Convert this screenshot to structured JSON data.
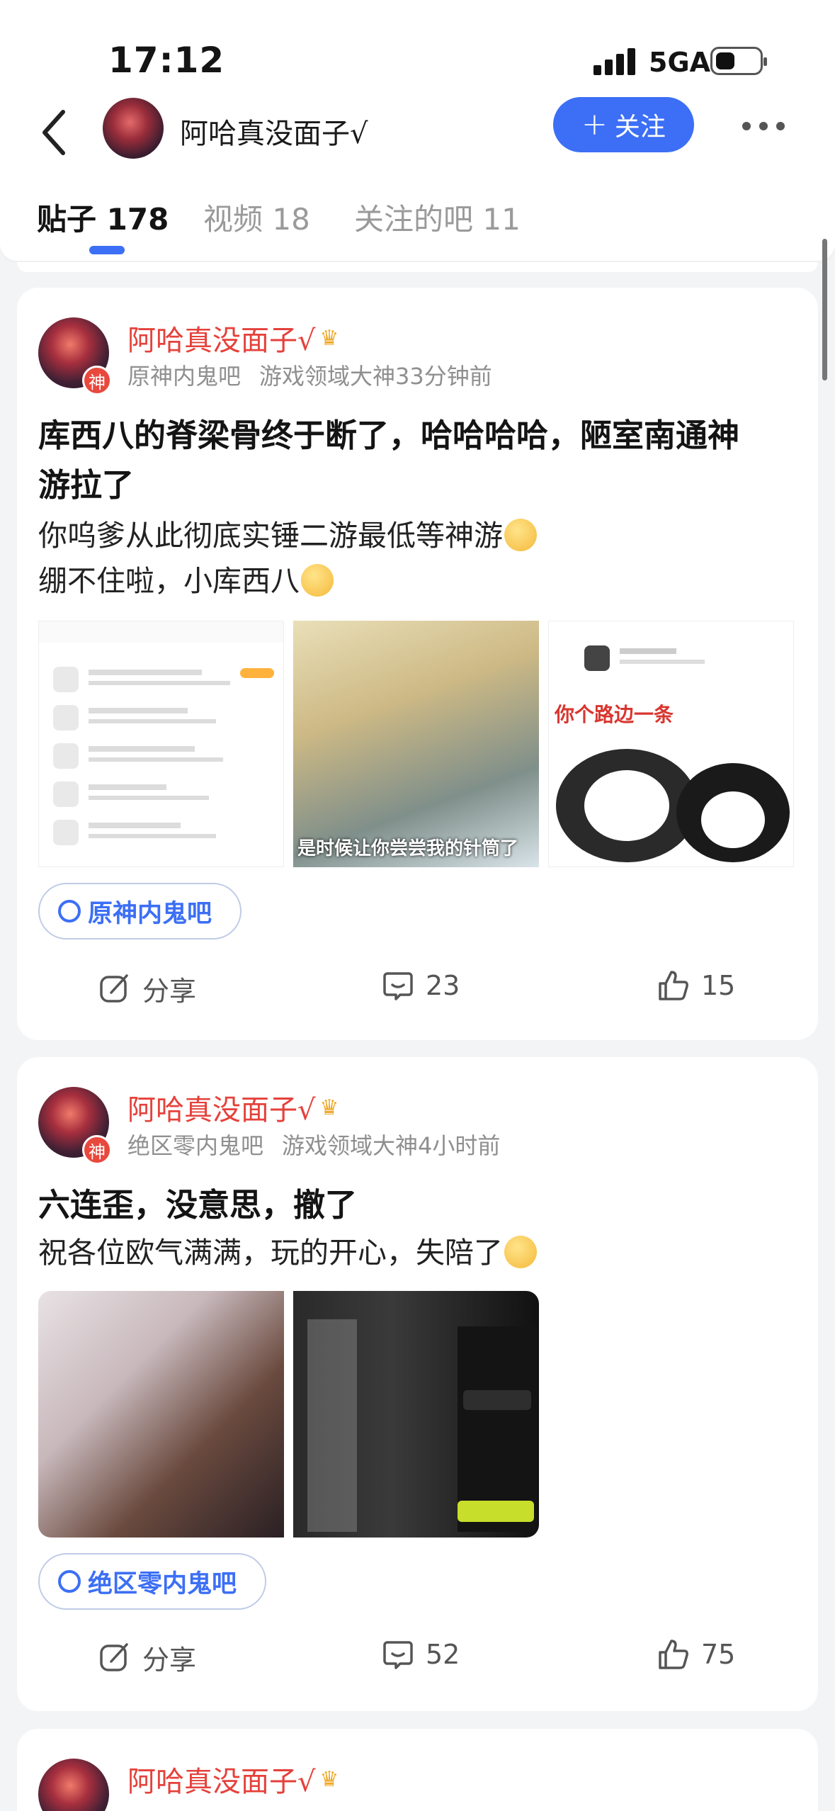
{
  "status": {
    "time": "17:12",
    "network": "5GA"
  },
  "header": {
    "user_name": "阿哈真没面子√",
    "follow_label": "关注"
  },
  "tabs": [
    {
      "label": "贴子 178"
    },
    {
      "label": "视频 18"
    },
    {
      "label": "关注的吧 11"
    }
  ],
  "posts": [
    {
      "author": "阿哈真没面子√",
      "badge": "神",
      "forum_meta": "原神内鬼吧",
      "rank_time": "游戏领域大神33分钟前",
      "title_line1": "库西八的脊梁骨终于断了，哈哈哈哈，陋室南通神",
      "title_line2": "游拉了",
      "body_line1": "你呜爹从此彻底实锤二游最低等神游",
      "body_line2": "绷不住啦，小库西八",
      "image_caption": "是时候让你尝尝我的针筒了",
      "image_text_a": "你个路边一条",
      "forum_tag": "原神内鬼吧",
      "share": "分享",
      "comments": "23",
      "likes": "15"
    },
    {
      "author": "阿哈真没面子√",
      "badge": "神",
      "forum_meta": "绝区零内鬼吧",
      "rank_time": "游戏领域大神4小时前",
      "title_line1": "六连歪，没意思，撤了",
      "body_line1": "祝各位欧气满满，玩的开心，失陪了",
      "forum_tag": "绝区零内鬼吧",
      "share": "分享",
      "comments": "52",
      "likes": "75"
    },
    {
      "author": "阿哈真没面子√",
      "badge": "神"
    }
  ]
}
